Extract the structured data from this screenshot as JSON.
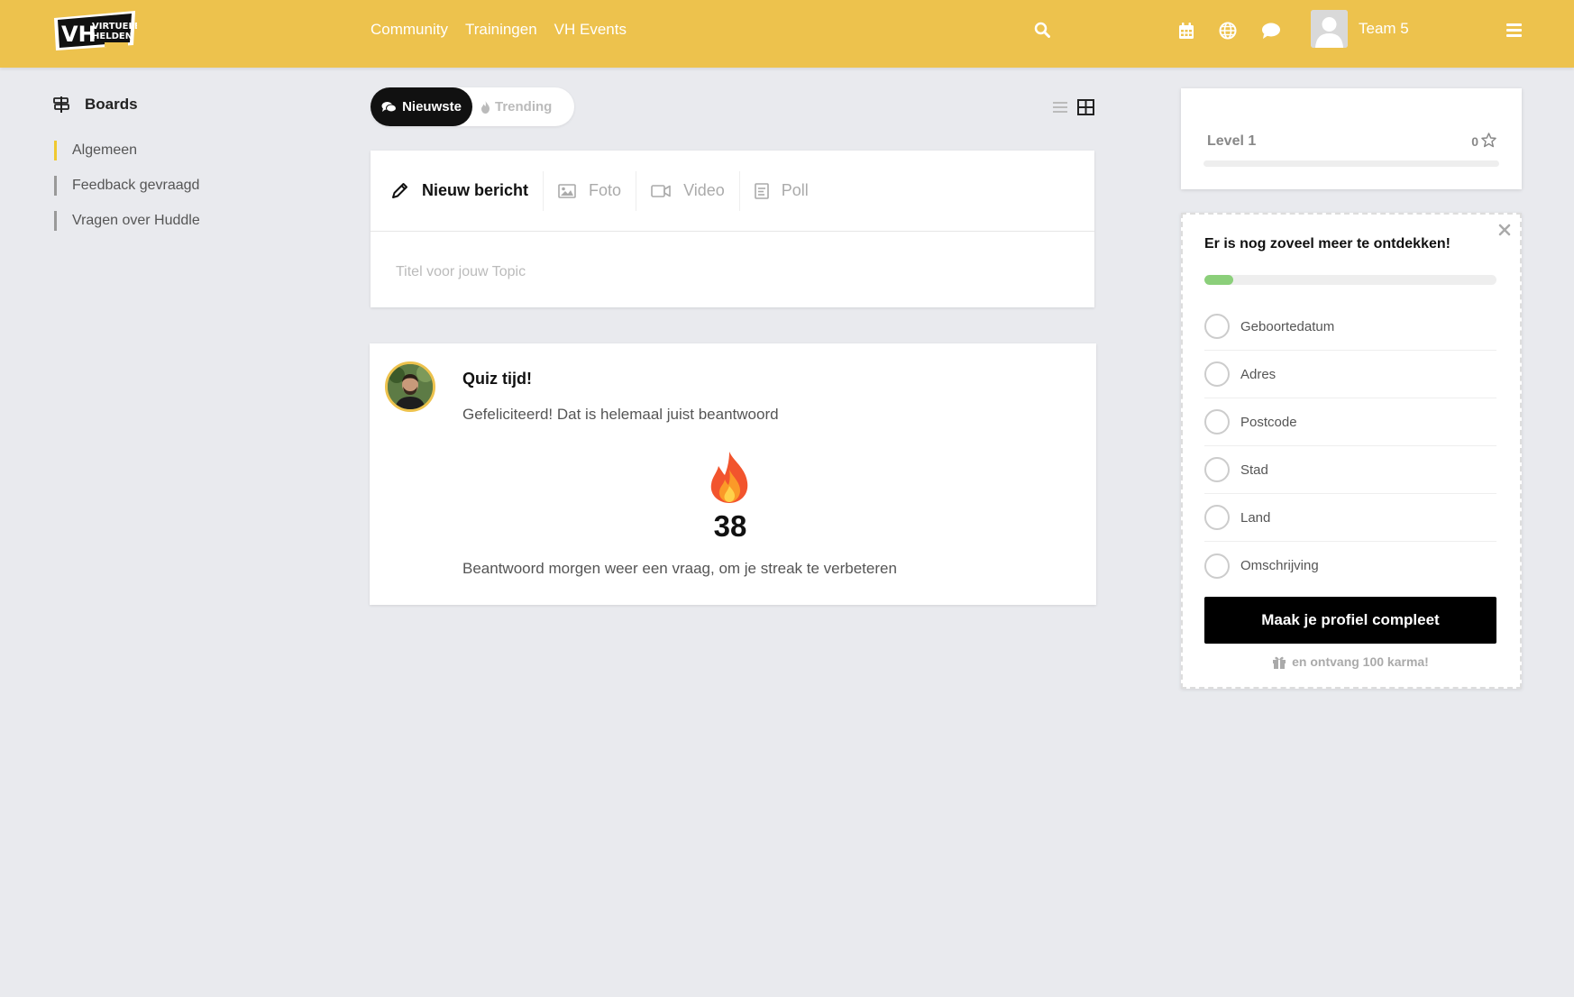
{
  "header": {
    "logo_text_line1": "VIRTUELE",
    "logo_text_line2": "HELDEN",
    "logo_text_initials": "VH",
    "nav": [
      "Community",
      "Trainingen",
      "VH Events"
    ],
    "team_name": "Team 5",
    "icons": [
      "search-icon",
      "calendar-icon",
      "globe-icon",
      "chat-icon",
      "menu-icon"
    ]
  },
  "sidebar": {
    "title": "Boards",
    "items": [
      {
        "label": "Algemeen",
        "active": true
      },
      {
        "label": "Feedback gevraagd",
        "active": false
      },
      {
        "label": "Vragen over Huddle",
        "active": false
      }
    ]
  },
  "sort": {
    "newest": "Nieuwste",
    "trending": "Trending"
  },
  "composer": {
    "tabs": [
      "Nieuw bericht",
      "Foto",
      "Video",
      "Poll"
    ],
    "placeholder": "Titel voor jouw Topic",
    "value": ""
  },
  "quiz": {
    "title": "Quiz tijd!",
    "message": "Gefeliciteerd! Dat is helemaal juist beantwoord",
    "streak": "38",
    "footer": "Beantwoord morgen weer een vraag, om je streak te verbeteren"
  },
  "level": {
    "label": "Level 1",
    "karma": "0",
    "progress": 0
  },
  "profile": {
    "title": "Er is nog zoveel meer te ontdekken!",
    "progress": 0.1,
    "fields": [
      "Geboortedatum",
      "Adres",
      "Postcode",
      "Stad",
      "Land",
      "Omschrijving"
    ],
    "button": "Maak je profiel compleet",
    "reward": "en ontvang 100 karma!"
  },
  "colors": {
    "brand": "#edc24d",
    "accent_green": "#8bcf7a",
    "board_active": "#f0c930"
  }
}
